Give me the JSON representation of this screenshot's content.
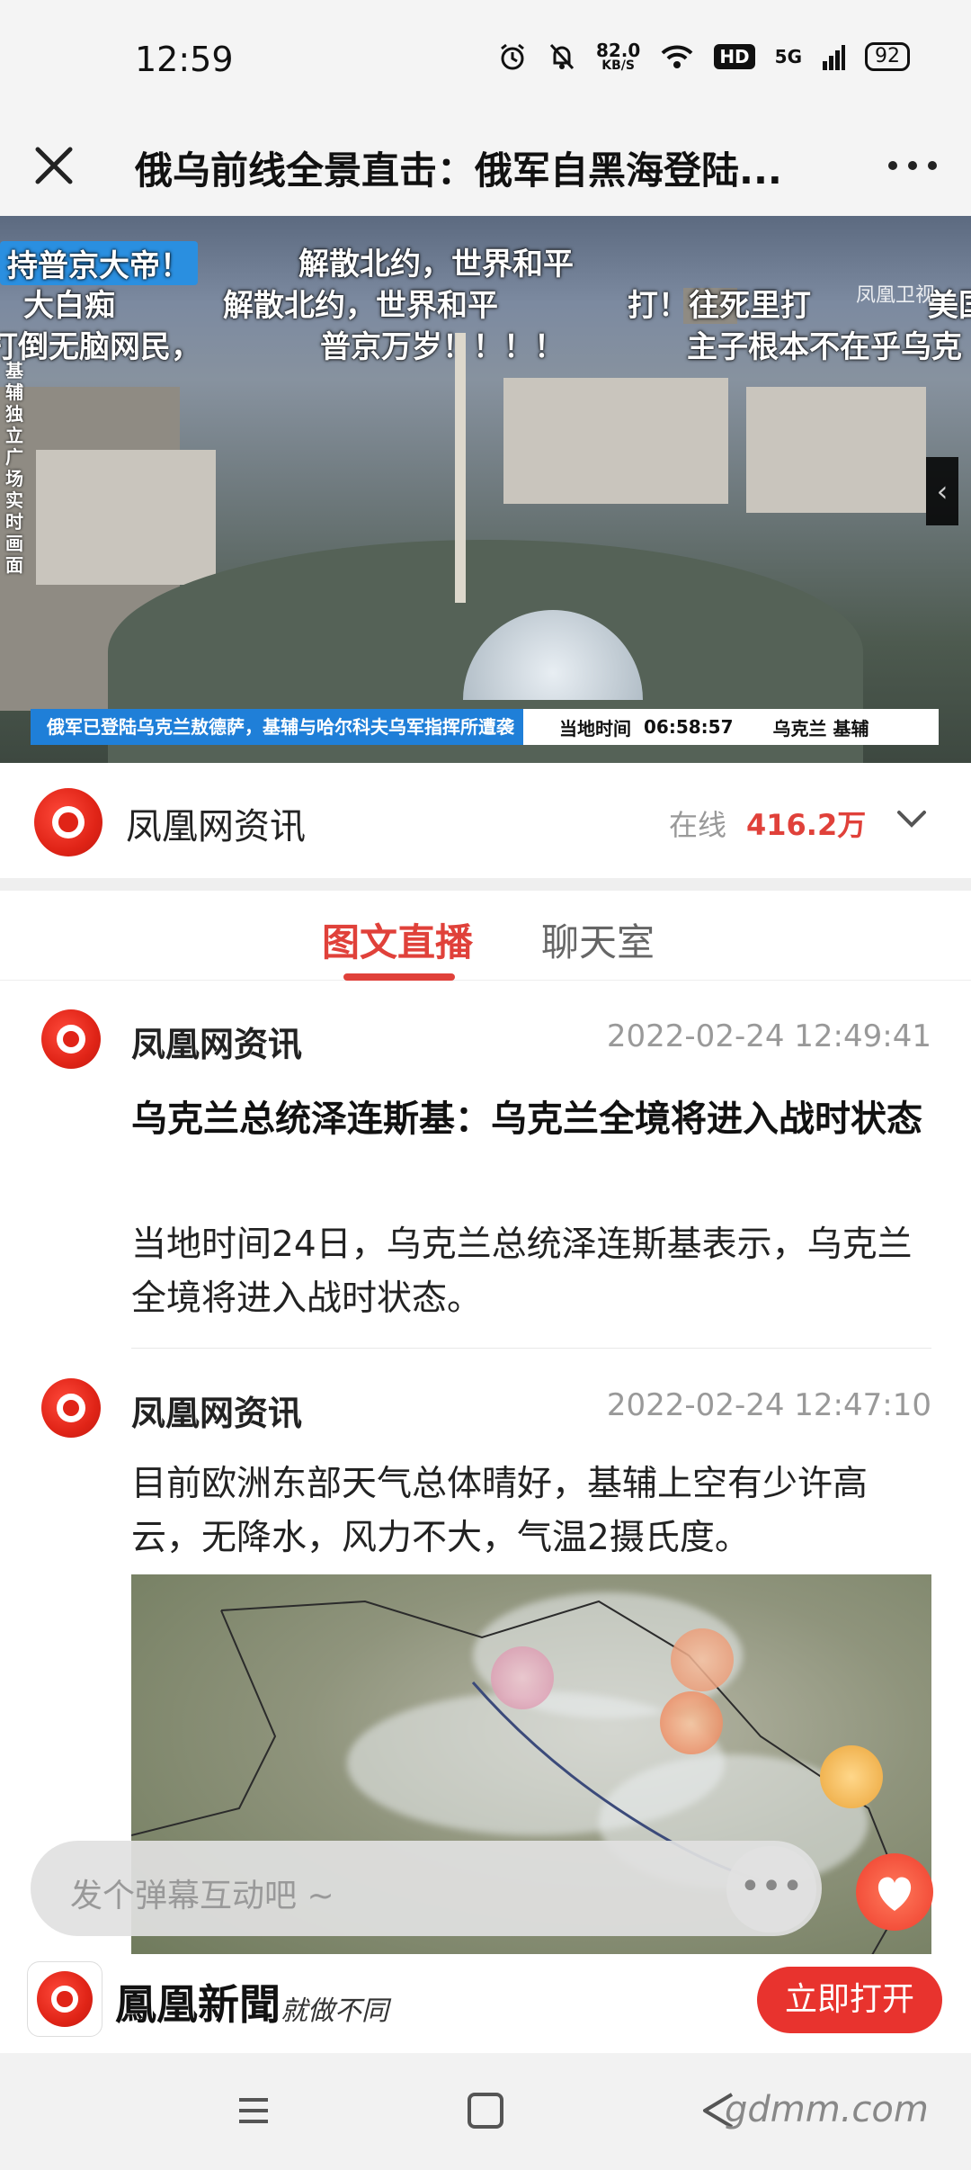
{
  "status_bar": {
    "time": "12:59",
    "net_speed_value": "82.0",
    "net_speed_unit": "KB/S",
    "hd": "HD",
    "signal": "5G",
    "battery": "92"
  },
  "title_bar": {
    "title": "俄乌前线全景直击：俄军自黑海登陆..."
  },
  "video": {
    "danmu": [
      "持普京大帝！",
      "解散北约，世界和平",
      "大白痴",
      "解散北约，世界和平",
      "打！往死里打",
      "美国",
      "打倒无脑网民，",
      "普京万岁！！！！",
      "主子根本不在乎乌克"
    ],
    "vertical_caption": "基辅独立广场实时画面",
    "watermark": "凤凰卫视",
    "ticker_news": "俄军已登陆乌克兰敖德萨，基辅与哈尔科夫乌军指挥所遭袭",
    "ticker_time_label": "当地时间",
    "ticker_time": "06:58:57",
    "ticker_place": "乌克兰 基辅"
  },
  "channel": {
    "name": "凤凰网资讯",
    "online_label": "在线",
    "online_count": "416.2万"
  },
  "tabs": {
    "live": "图文直播",
    "chat": "聊天室"
  },
  "posts": [
    {
      "author": "凤凰网资讯",
      "time": "2022-02-24 12:49:41",
      "headline": "乌克兰总统泽连斯基：乌克兰全境将进入战时状态",
      "body": "当地时间24日，乌克兰总统泽连斯基表示，乌克兰全境将进入战时状态。"
    },
    {
      "author": "凤凰网资讯",
      "time": "2022-02-24 12:47:10",
      "body": "目前欧洲东部天气总体晴好，基辅上空有少许高云，无降水，风力不大，气温2摄氏度。"
    }
  ],
  "comment": {
    "placeholder": "发个弹幕互动吧 ~",
    "dots": "•••"
  },
  "app_banner": {
    "name": "鳳凰新聞",
    "slogan": "就做不同",
    "open_button": "立即打开"
  },
  "nav_bar": {
    "watermark": "gdmm.com"
  },
  "colors": {
    "accent_red": "#e0413a",
    "open_button": "#e8332e"
  }
}
